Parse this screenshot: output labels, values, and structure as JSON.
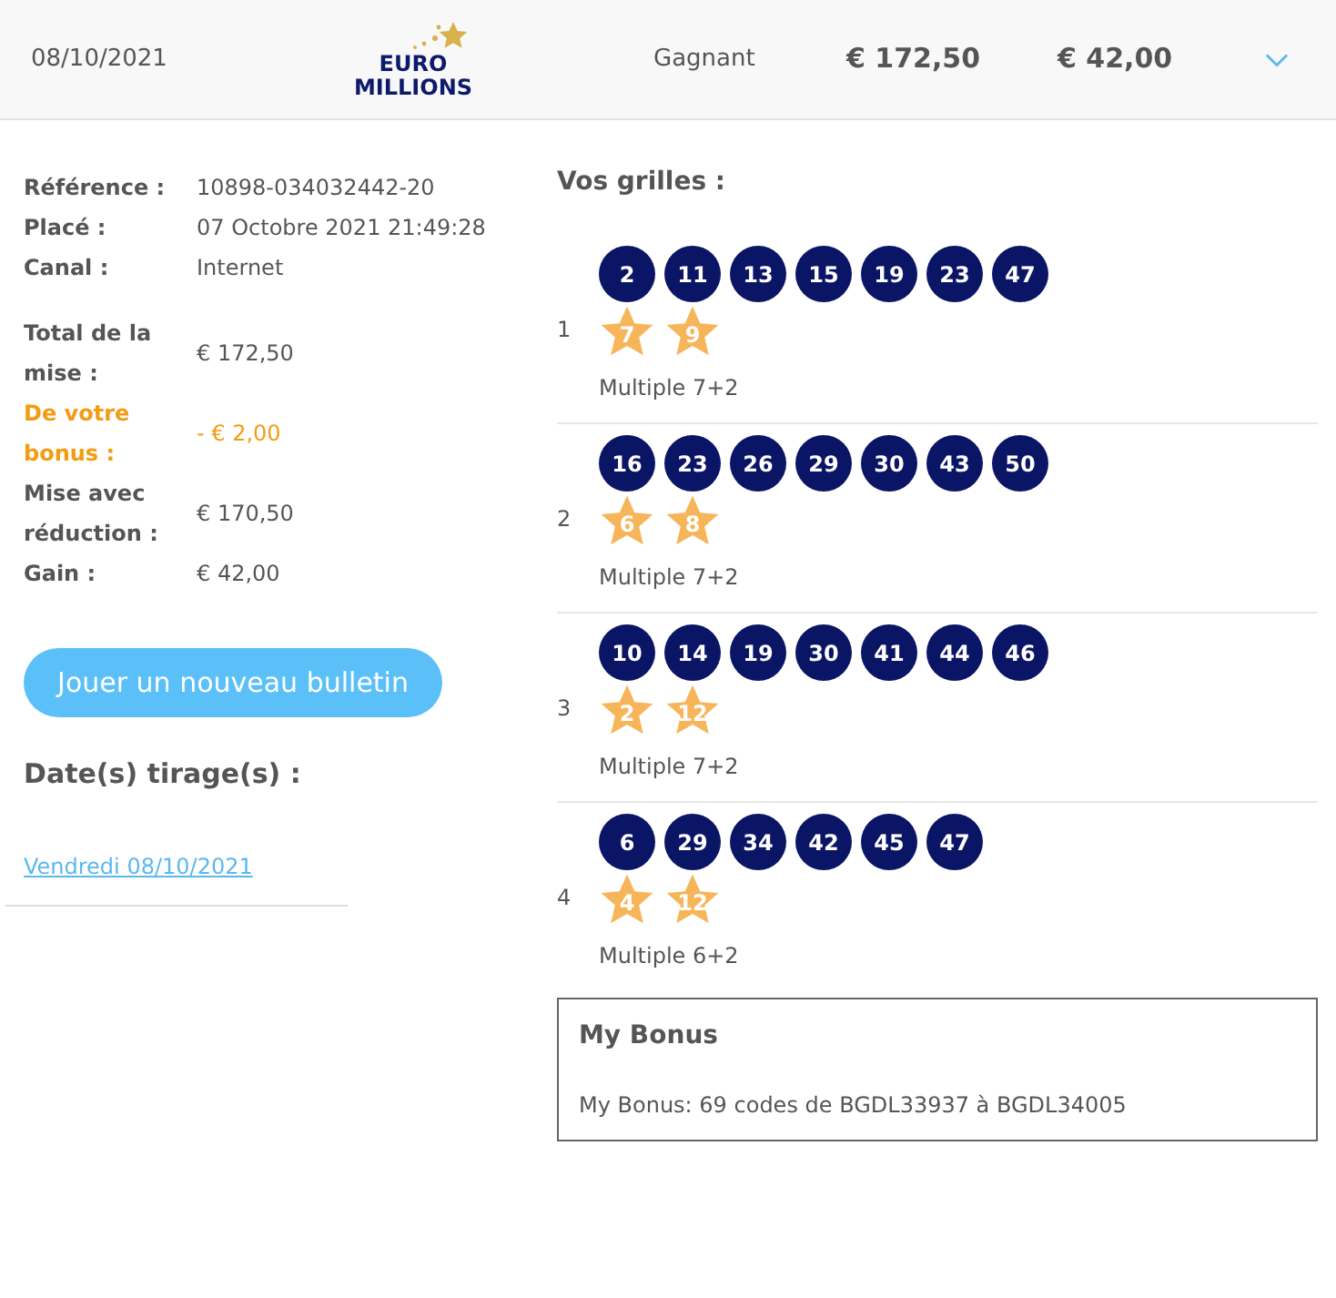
{
  "header": {
    "date": "08/10/2021",
    "logo": {
      "line1": "EURO",
      "line2": "MILLIONS"
    },
    "status": "Gagnant",
    "stake": "€ 172,50",
    "winnings": "€ 42,00",
    "expanded": false
  },
  "details": [
    {
      "label": "Référence :",
      "value": "10898-034032442-20",
      "kind": "normal"
    },
    {
      "label": "Placé :",
      "value": "07 Octobre 2021 21:49:28",
      "kind": "normal"
    },
    {
      "label": "Canal :",
      "value": "Internet",
      "kind": "normal"
    },
    {
      "label": "Total de la mise :",
      "value": "€ 172,50",
      "kind": "normal"
    },
    {
      "label": "De votre bonus :",
      "value": "- € 2,00",
      "kind": "bonus"
    },
    {
      "label": "Mise avec réduction :",
      "value": "€ 170,50",
      "kind": "normal"
    },
    {
      "label": "Gain :",
      "value": "€ 42,00",
      "kind": "normal"
    }
  ],
  "play_button": "Jouer un nouveau bulletin",
  "draw_dates": {
    "title": "Date(s) tirage(s) :",
    "links": [
      "Vendredi 08/10/2021"
    ]
  },
  "grids": {
    "title": "Vos grilles :",
    "items": [
      {
        "index": "1",
        "numbers": [
          "2",
          "11",
          "13",
          "15",
          "19",
          "23",
          "47"
        ],
        "stars": [
          "7",
          "9"
        ],
        "type": "Multiple 7+2"
      },
      {
        "index": "2",
        "numbers": [
          "16",
          "23",
          "26",
          "29",
          "30",
          "43",
          "50"
        ],
        "stars": [
          "6",
          "8"
        ],
        "type": "Multiple 7+2"
      },
      {
        "index": "3",
        "numbers": [
          "10",
          "14",
          "19",
          "30",
          "41",
          "44",
          "46"
        ],
        "stars": [
          "2",
          "12"
        ],
        "type": "Multiple 7+2"
      },
      {
        "index": "4",
        "numbers": [
          "6",
          "29",
          "34",
          "42",
          "45",
          "47"
        ],
        "stars": [
          "4",
          "12"
        ],
        "type": "Multiple 6+2"
      }
    ]
  },
  "bonus": {
    "title": "My Bonus",
    "text": "My Bonus: 69 codes de BGDL33937 à BGDL34005"
  }
}
